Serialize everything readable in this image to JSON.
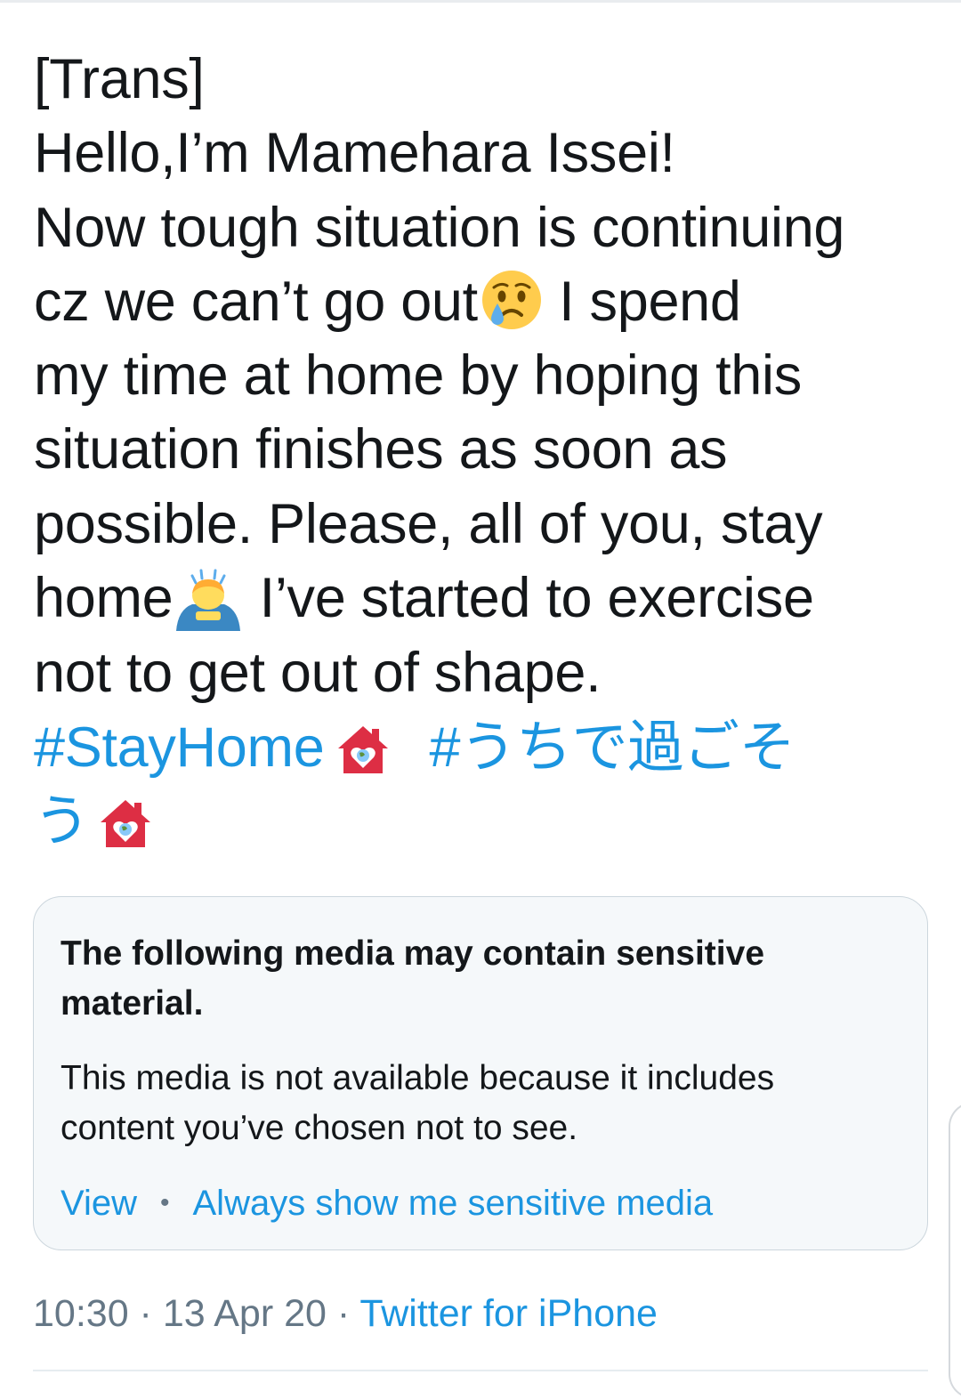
{
  "tweet": {
    "lines": [
      "[Trans]",
      "Hello,I’m Mamehara Issei!",
      "Now tough situation is continuing",
      "cz we can’t go out",
      " I spend",
      "my time at home by hoping this",
      "situation finishes as soon as",
      "possible. Please, all of you, stay",
      "home",
      " I’ve started to exercise",
      "not to get out of shape."
    ],
    "hashtags": [
      "#StayHome",
      "#うちで過ごそ",
      "う"
    ],
    "emoji_names": [
      "crying-face-icon",
      "person-bowing-icon",
      "house-with-earth-heart-icon"
    ]
  },
  "media_notice": {
    "title": "The following media may contain sensitive material.",
    "body": "This media is not available because it includes content you’ve chosen not to see.",
    "view_label": "View",
    "separator": "•",
    "always_show_label": "Always show me sensitive media"
  },
  "meta": {
    "time": "10:30",
    "sep1": " · ",
    "date": "13 Apr 20",
    "sep2": " · ",
    "source": "Twitter for iPhone"
  },
  "colors": {
    "text": "#14171a",
    "link": "#1b95e0",
    "muted": "#657786",
    "card_bg": "#f5f8fa",
    "card_border": "#ccd6dd",
    "emoji_red": "#dd2e44",
    "emoji_yellow": "#ffcc4d"
  }
}
